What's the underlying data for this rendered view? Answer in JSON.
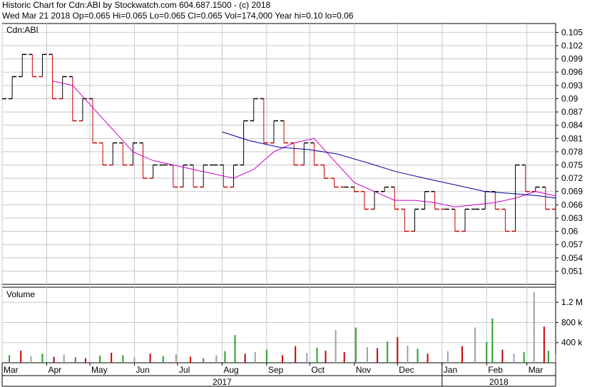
{
  "header": {
    "line1": "Historic Chart for Cdn:ABI by Stockwatch.com 604.687.1500 - (c) 2018",
    "line2": "Wed Mar 21 2018   Op=0.065   Hi=0.065   Lo=0.065   Cl=0.065   Vol=174,000   Year hi=0.10   lo=0.06"
  },
  "colors": {
    "price_up": "#000000",
    "price_down": "#cc0000",
    "ma_short": "#cc00cc",
    "ma_long": "#000099",
    "grid": "#c8c8c8",
    "vol_up": "#2a9e2a",
    "vol_down": "#cc0000",
    "vol_neutral": "#a0a0a0"
  },
  "chart_data": [
    {
      "type": "line",
      "title": "Cdn:ABI",
      "chart_subtype": "step price chart with moving averages",
      "xlabel": "",
      "ylabel": "",
      "ylim": [
        0.048,
        0.107
      ],
      "y_axis_side": "right",
      "y_ticks": [
        "0.105",
        "0.102",
        "0.099",
        "0.096",
        "0.093",
        "0.09",
        "0.087",
        "0.084",
        "0.081",
        "0.078",
        "0.075",
        "0.072",
        "0.069",
        "0.066",
        "0.063",
        "0.06",
        "0.057",
        "0.054",
        "0.051"
      ],
      "x_tick_labels": [
        "Mar",
        "Apr",
        "May",
        "Jun",
        "Jul",
        "Aug",
        "Sep",
        "Oct",
        "Nov",
        "Dec",
        "Jan",
        "Feb",
        "Mar"
      ],
      "x_tick_dates": [
        "2017-03-01",
        "2017-04-01",
        "2017-05-01",
        "2017-06-01",
        "2017-07-01",
        "2017-08-01",
        "2017-09-01",
        "2017-10-01",
        "2017-11-01",
        "2017-12-01",
        "2018-01-01",
        "2018-02-01",
        "2018-03-01"
      ],
      "year_labels": [
        "2017",
        "2018"
      ],
      "xlim": [
        "2017-03-01",
        "2018-03-21"
      ],
      "grid": true,
      "series": [
        {
          "kind": "price_step",
          "x": [
            "2017-03-01",
            "2017-03-08",
            "2017-03-15",
            "2017-03-22",
            "2017-03-29",
            "2017-04-05",
            "2017-04-12",
            "2017-04-19",
            "2017-04-26",
            "2017-05-03",
            "2017-05-10",
            "2017-05-17",
            "2017-05-24",
            "2017-05-31",
            "2017-06-07",
            "2017-06-14",
            "2017-06-21",
            "2017-06-28",
            "2017-07-05",
            "2017-07-12",
            "2017-07-19",
            "2017-07-26",
            "2017-08-02",
            "2017-08-09",
            "2017-08-16",
            "2017-08-23",
            "2017-08-30",
            "2017-09-06",
            "2017-09-13",
            "2017-09-20",
            "2017-09-27",
            "2017-10-04",
            "2017-10-11",
            "2017-10-18",
            "2017-10-25",
            "2017-11-01",
            "2017-11-08",
            "2017-11-15",
            "2017-11-22",
            "2017-11-29",
            "2017-12-06",
            "2017-12-13",
            "2017-12-20",
            "2017-12-27",
            "2018-01-03",
            "2018-01-10",
            "2018-01-17",
            "2018-01-24",
            "2018-01-31",
            "2018-02-07",
            "2018-02-14",
            "2018-02-21",
            "2018-02-28",
            "2018-03-07",
            "2018-03-14",
            "2018-03-21"
          ],
          "values": [
            0.09,
            0.095,
            0.1,
            0.095,
            0.1,
            0.09,
            0.095,
            0.085,
            0.09,
            0.08,
            0.075,
            0.08,
            0.075,
            0.08,
            0.072,
            0.075,
            0.075,
            0.07,
            0.075,
            0.07,
            0.075,
            0.075,
            0.07,
            0.075,
            0.085,
            0.09,
            0.08,
            0.085,
            0.08,
            0.075,
            0.08,
            0.075,
            0.072,
            0.07,
            0.07,
            0.069,
            0.065,
            0.069,
            0.07,
            0.065,
            0.06,
            0.065,
            0.069,
            0.065,
            0.065,
            0.06,
            0.065,
            0.065,
            0.069,
            0.065,
            0.06,
            0.075,
            0.069,
            0.07,
            0.065,
            0.065
          ]
        },
        {
          "kind": "moving_average_short",
          "x": [
            "2017-04-05",
            "2017-04-19",
            "2017-05-03",
            "2017-05-17",
            "2017-05-31",
            "2017-06-14",
            "2017-06-28",
            "2017-07-12",
            "2017-07-26",
            "2017-08-09",
            "2017-08-23",
            "2017-09-06",
            "2017-09-20",
            "2017-10-04",
            "2017-10-18",
            "2017-11-01",
            "2017-11-15",
            "2017-11-29",
            "2017-12-13",
            "2017-12-27",
            "2018-01-10",
            "2018-01-24",
            "2018-02-07",
            "2018-02-21",
            "2018-03-07",
            "2018-03-21"
          ],
          "values": [
            0.094,
            0.093,
            0.088,
            0.083,
            0.078,
            0.076,
            0.075,
            0.074,
            0.073,
            0.072,
            0.074,
            0.078,
            0.08,
            0.081,
            0.076,
            0.071,
            0.069,
            0.067,
            0.067,
            0.0665,
            0.0655,
            0.066,
            0.0665,
            0.0675,
            0.069,
            0.068
          ]
        },
        {
          "kind": "moving_average_long",
          "x": [
            "2017-08-01",
            "2017-08-20",
            "2017-09-10",
            "2017-09-30",
            "2017-10-20",
            "2017-11-10",
            "2017-11-30",
            "2017-12-20",
            "2018-01-10",
            "2018-01-31",
            "2018-02-20",
            "2018-03-10",
            "2018-03-21"
          ],
          "values": [
            0.0825,
            0.0805,
            0.079,
            0.0785,
            0.0775,
            0.0755,
            0.0735,
            0.072,
            0.0705,
            0.069,
            0.0685,
            0.068,
            0.0675
          ]
        }
      ]
    },
    {
      "type": "bar",
      "title": "Volume",
      "y_axis_side": "right",
      "y_ticks": [
        "1.2 M",
        "800 k",
        "400 k"
      ],
      "ylim": [
        0,
        1500000
      ],
      "grid": true,
      "x": [
        "2017-03-06",
        "2017-03-14",
        "2017-03-21",
        "2017-03-29",
        "2017-04-06",
        "2017-04-13",
        "2017-04-21",
        "2017-04-28",
        "2017-05-08",
        "2017-05-16",
        "2017-05-24",
        "2017-06-01",
        "2017-06-12",
        "2017-06-21",
        "2017-06-30",
        "2017-07-10",
        "2017-07-19",
        "2017-07-28",
        "2017-08-03",
        "2017-08-10",
        "2017-08-17",
        "2017-08-24",
        "2017-09-01",
        "2017-09-12",
        "2017-09-21",
        "2017-09-29",
        "2017-10-06",
        "2017-10-12",
        "2017-10-19",
        "2017-10-25",
        "2017-11-02",
        "2017-11-10",
        "2017-11-17",
        "2017-11-24",
        "2017-12-01",
        "2017-12-08",
        "2017-12-15",
        "2017-12-22",
        "2018-01-05",
        "2018-01-15",
        "2018-01-24",
        "2018-02-01",
        "2018-02-05",
        "2018-02-12",
        "2018-02-20",
        "2018-02-27",
        "2018-03-06",
        "2018-03-13",
        "2018-03-16",
        "2018-03-21"
      ],
      "values": [
        150000,
        240000,
        130000,
        180000,
        120000,
        160000,
        110000,
        90000,
        140000,
        200000,
        150000,
        110000,
        180000,
        130000,
        170000,
        120000,
        90000,
        150000,
        230000,
        550000,
        180000,
        210000,
        260000,
        150000,
        330000,
        190000,
        300000,
        240000,
        650000,
        210000,
        700000,
        310000,
        290000,
        420000,
        510000,
        340000,
        280000,
        180000,
        230000,
        330000,
        700000,
        410000,
        880000,
        260000,
        180000,
        210000,
        1400000,
        720000,
        240000,
        174000
      ],
      "directions": [
        "up",
        "down",
        "neutral",
        "up",
        "down",
        "neutral",
        "up",
        "down",
        "up",
        "down",
        "up",
        "neutral",
        "down",
        "up",
        "neutral",
        "down",
        "up",
        "neutral",
        "up",
        "up",
        "down",
        "neutral",
        "up",
        "down",
        "down",
        "neutral",
        "up",
        "down",
        "neutral",
        "down",
        "up",
        "neutral",
        "down",
        "up",
        "down",
        "neutral",
        "up",
        "down",
        "neutral",
        "down",
        "neutral",
        "up",
        "up",
        "down",
        "neutral",
        "up",
        "neutral",
        "down",
        "up",
        "neutral"
      ]
    }
  ]
}
